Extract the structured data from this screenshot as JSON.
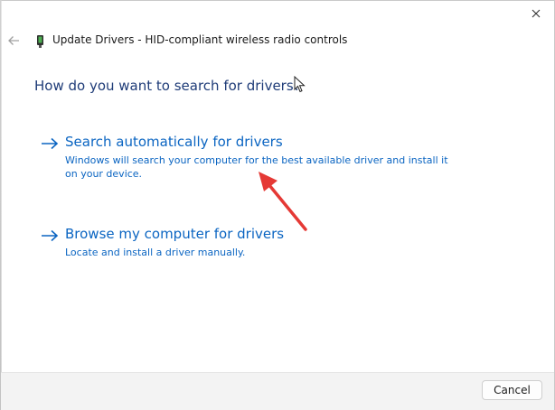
{
  "dialog": {
    "title": "Update Drivers - HID-compliant wireless radio controls",
    "heading": "How do you want to search for drivers?"
  },
  "options": [
    {
      "title": "Search automatically for drivers",
      "description": "Windows will search your computer for the best available driver and install it on your device."
    },
    {
      "title": "Browse my computer for drivers",
      "description": "Locate and install a driver manually."
    }
  ],
  "footer": {
    "cancel_label": "Cancel"
  },
  "icons": {
    "close": "close-icon",
    "back": "back-arrow-icon",
    "device": "device-icon",
    "option_arrow": "arrow-right-icon",
    "cursor": "mouse-cursor-icon",
    "annotation": "red-annotation-arrow-icon"
  },
  "colors": {
    "heading": "#1f3c78",
    "link": "#0b65c2",
    "annotation": "#e53935",
    "footer_bg": "#f3f3f3"
  }
}
